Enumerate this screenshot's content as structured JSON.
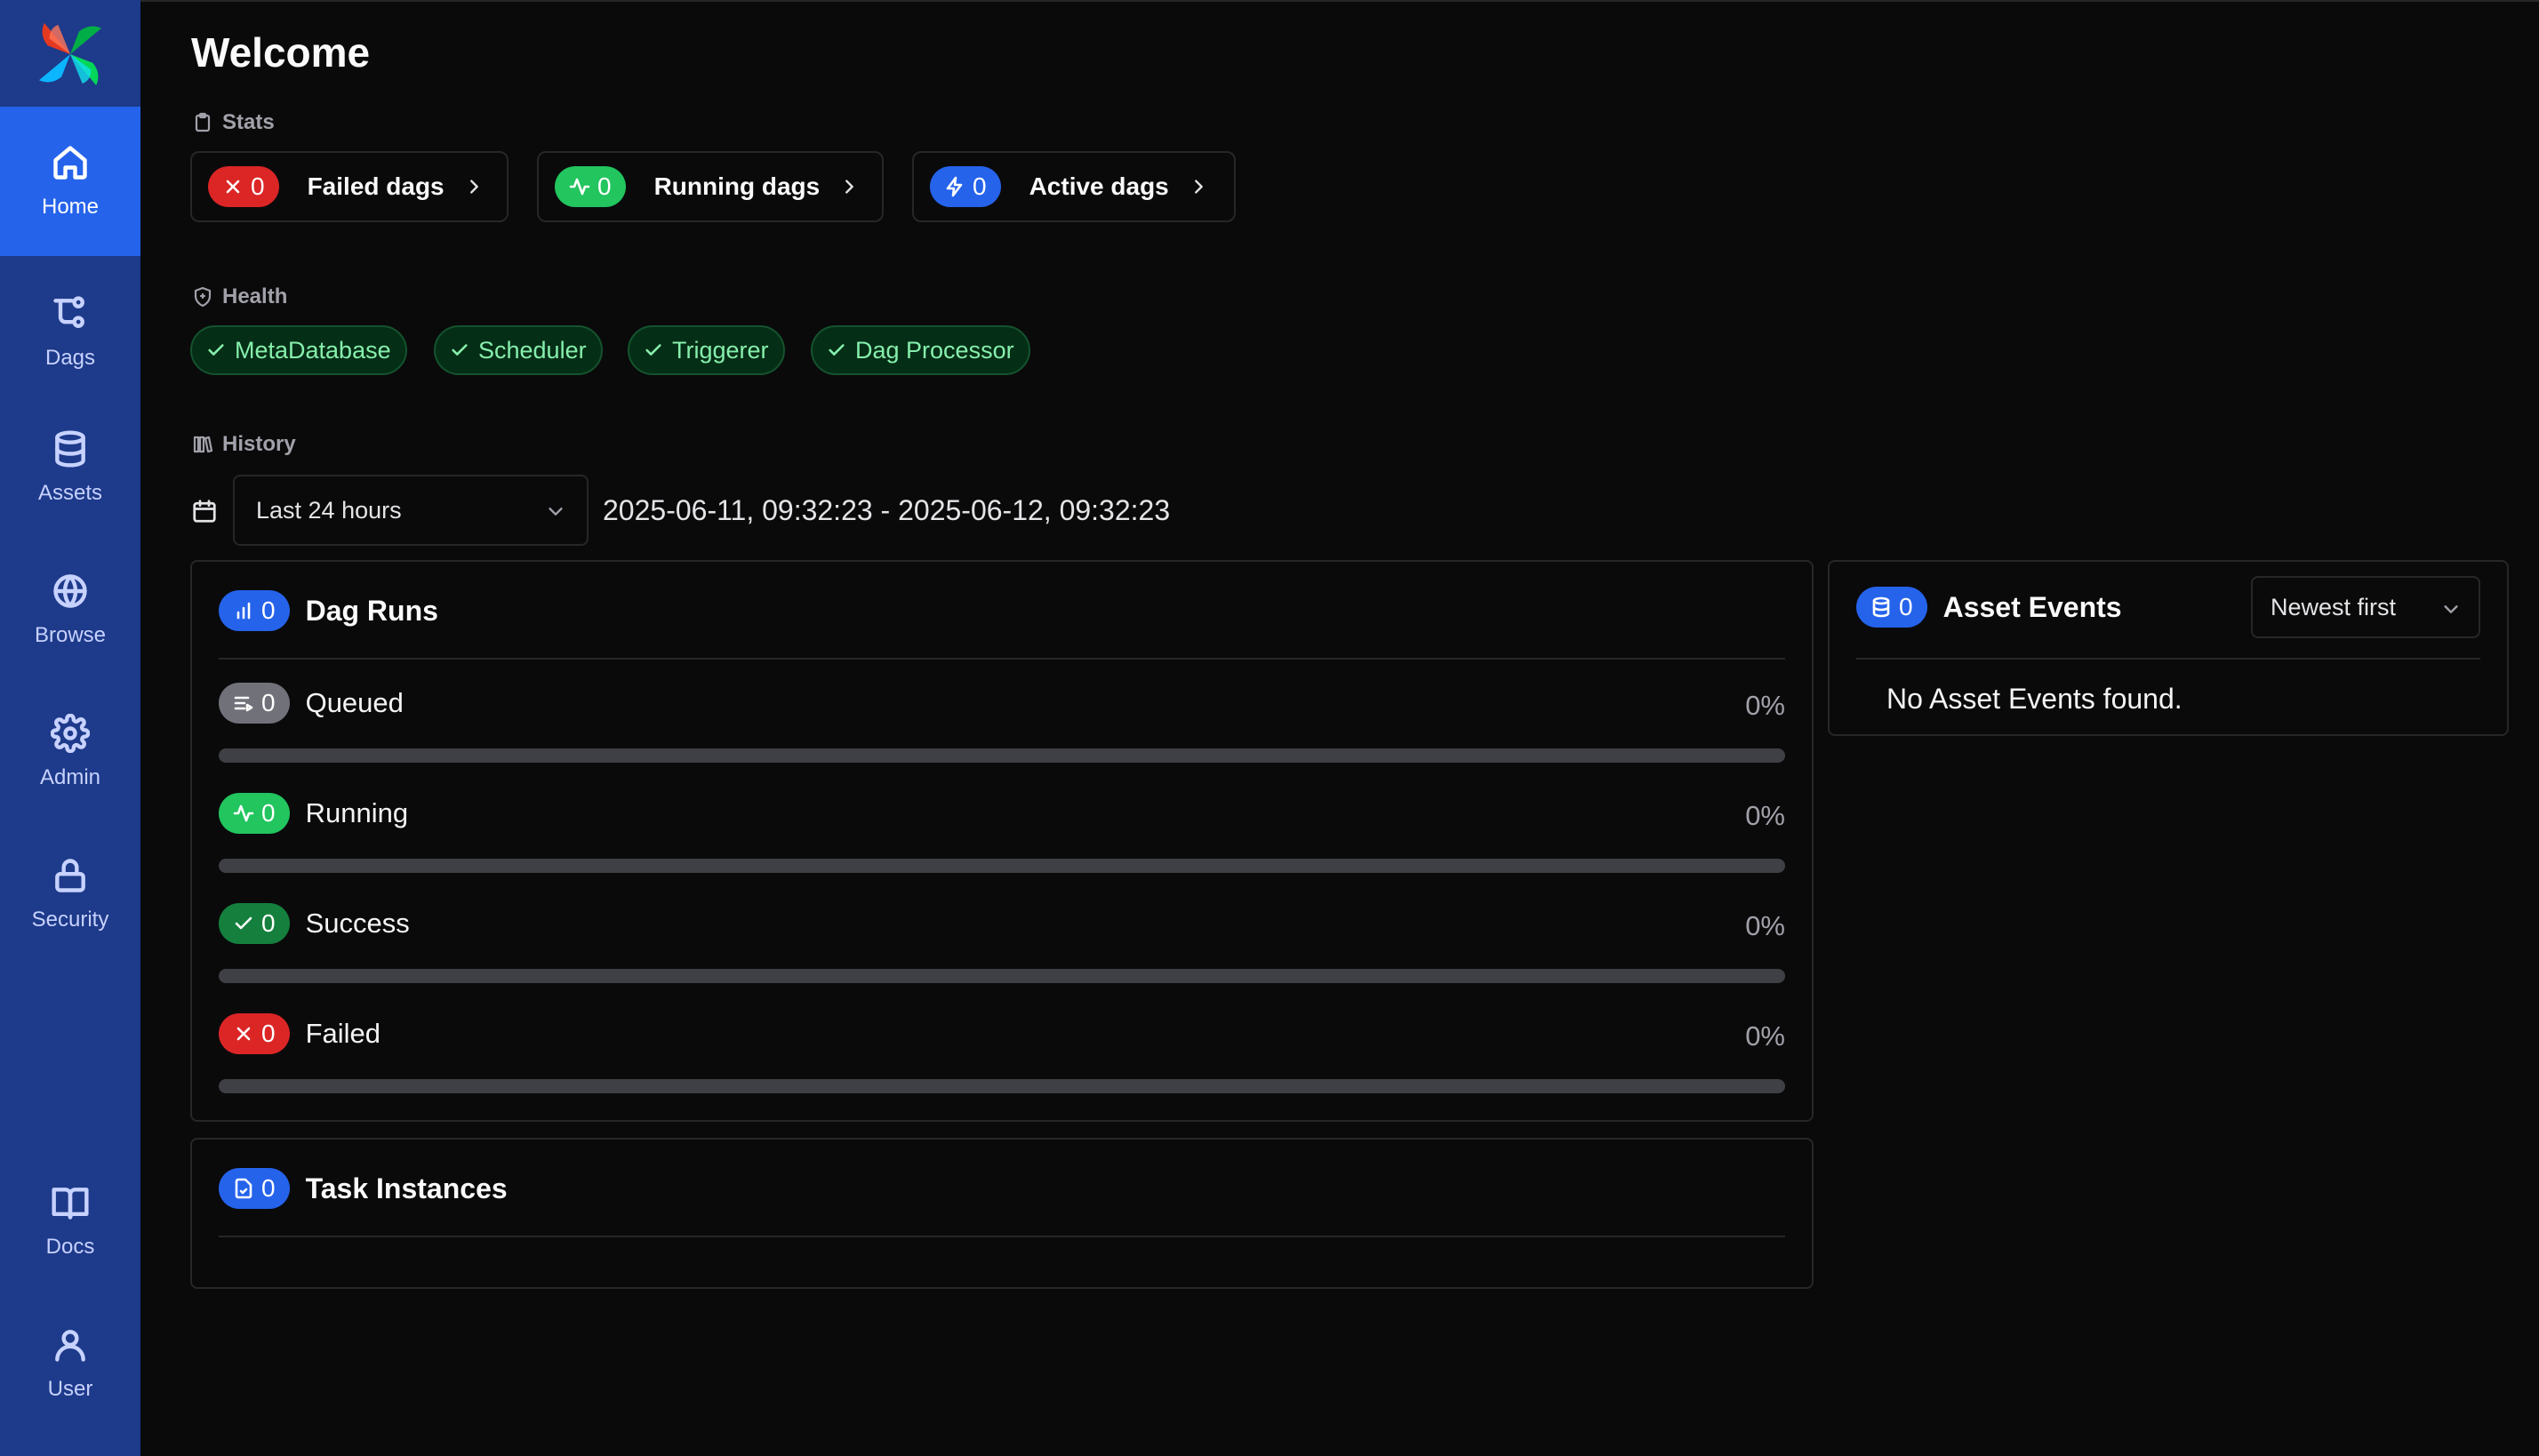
{
  "sidebar": {
    "logo": "airflow-pinwheel-logo",
    "items": [
      {
        "label": "Home",
        "icon": "home-icon",
        "active": true
      },
      {
        "label": "Dags",
        "icon": "dags-icon"
      },
      {
        "label": "Assets",
        "icon": "database-icon"
      },
      {
        "label": "Browse",
        "icon": "globe-icon"
      },
      {
        "label": "Admin",
        "icon": "gear-icon"
      },
      {
        "label": "Security",
        "icon": "lock-icon"
      }
    ],
    "bottom_items": [
      {
        "label": "Docs",
        "icon": "book-icon"
      },
      {
        "label": "User",
        "icon": "user-icon"
      }
    ]
  },
  "page": {
    "title": "Welcome"
  },
  "stats": {
    "label": "Stats",
    "cards": [
      {
        "count": "0",
        "label": "Failed dags",
        "color": "#dc2626",
        "icon": "x-icon"
      },
      {
        "count": "0",
        "label": "Running dags",
        "color": "#22c55e",
        "icon": "activity-icon"
      },
      {
        "count": "0",
        "label": "Active dags",
        "color": "#2563eb",
        "icon": "zap-icon"
      }
    ]
  },
  "health": {
    "label": "Health",
    "items": [
      "MetaDatabase",
      "Scheduler",
      "Triggerer",
      "Dag Processor"
    ],
    "status_color": "#86efac"
  },
  "history": {
    "label": "History",
    "range_select": "Last 24 hours",
    "range_text": "2025-06-11, 09:32:23 - 2025-06-12, 09:32:23"
  },
  "dag_runs": {
    "count": "0",
    "title": "Dag Runs",
    "rows": [
      {
        "count": "0",
        "label": "Queued",
        "pct": "0%",
        "fraction": 0,
        "color": "#71717a",
        "icon": "queue-icon"
      },
      {
        "count": "0",
        "label": "Running",
        "pct": "0%",
        "fraction": 0,
        "color": "#22c55e",
        "icon": "activity-icon"
      },
      {
        "count": "0",
        "label": "Success",
        "pct": "0%",
        "fraction": 0,
        "color": "#15803d",
        "icon": "check-icon"
      },
      {
        "count": "0",
        "label": "Failed",
        "pct": "0%",
        "fraction": 0,
        "color": "#dc2626",
        "icon": "x-icon"
      }
    ]
  },
  "task_instances": {
    "count": "0",
    "title": "Task Instances"
  },
  "asset_events": {
    "count": "0",
    "title": "Asset Events",
    "sort": "Newest first",
    "empty": "No Asset Events found."
  }
}
